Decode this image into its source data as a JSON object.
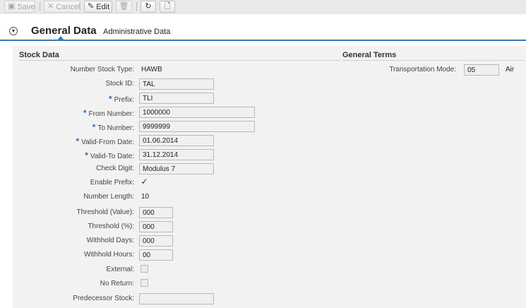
{
  "toolbar": {
    "save_label": "Save",
    "cancel_label": "Cancel",
    "edit_label": "Edit"
  },
  "tabs": {
    "active": "General Data",
    "other": "Administrative Data"
  },
  "stock_data": {
    "title": "Stock Data",
    "number_stock_type_label": "Number Stock Type:",
    "number_stock_type_value": "HAWB",
    "stock_id_label": "Stock ID:",
    "stock_id_value": "TAL",
    "prefix_label": "Prefix:",
    "prefix_value": "TLI",
    "from_number_label": "From Number:",
    "from_number_value": "1000000",
    "to_number_label": "To Number:",
    "to_number_value": "9999999",
    "valid_from_label": "Valid-From Date:",
    "valid_from_value": "01.06.2014",
    "valid_to_label": "Valid-To Date:",
    "valid_to_value": "31.12.2014",
    "check_digit_label": "Check Digit:",
    "check_digit_value": "Modulus 7",
    "enable_prefix_label": "Enable Prefix:",
    "enable_prefix_mark": "✓",
    "number_length_label": "Number Length:",
    "number_length_value": "10",
    "threshold_value_label": "Threshold (Value):",
    "threshold_value_value": "000",
    "threshold_pct_label": "Threshold (%):",
    "threshold_pct_value": "000",
    "withhold_days_label": "Withhold Days:",
    "withhold_days_value": "000",
    "withhold_hours_label": "Withhold Hours:",
    "withhold_hours_value": "00",
    "external_label": "External:",
    "no_return_label": "No Return:",
    "predecessor_label": "Predecessor Stock:",
    "predecessor_value": ""
  },
  "general_terms": {
    "title": "General Terms",
    "transport_mode_label": "Transportation Mode:",
    "transport_mode_code": "05",
    "transport_mode_text": "Air"
  },
  "colors": {
    "accent": "#3b78b5",
    "required_star": "#2f6fb5"
  }
}
